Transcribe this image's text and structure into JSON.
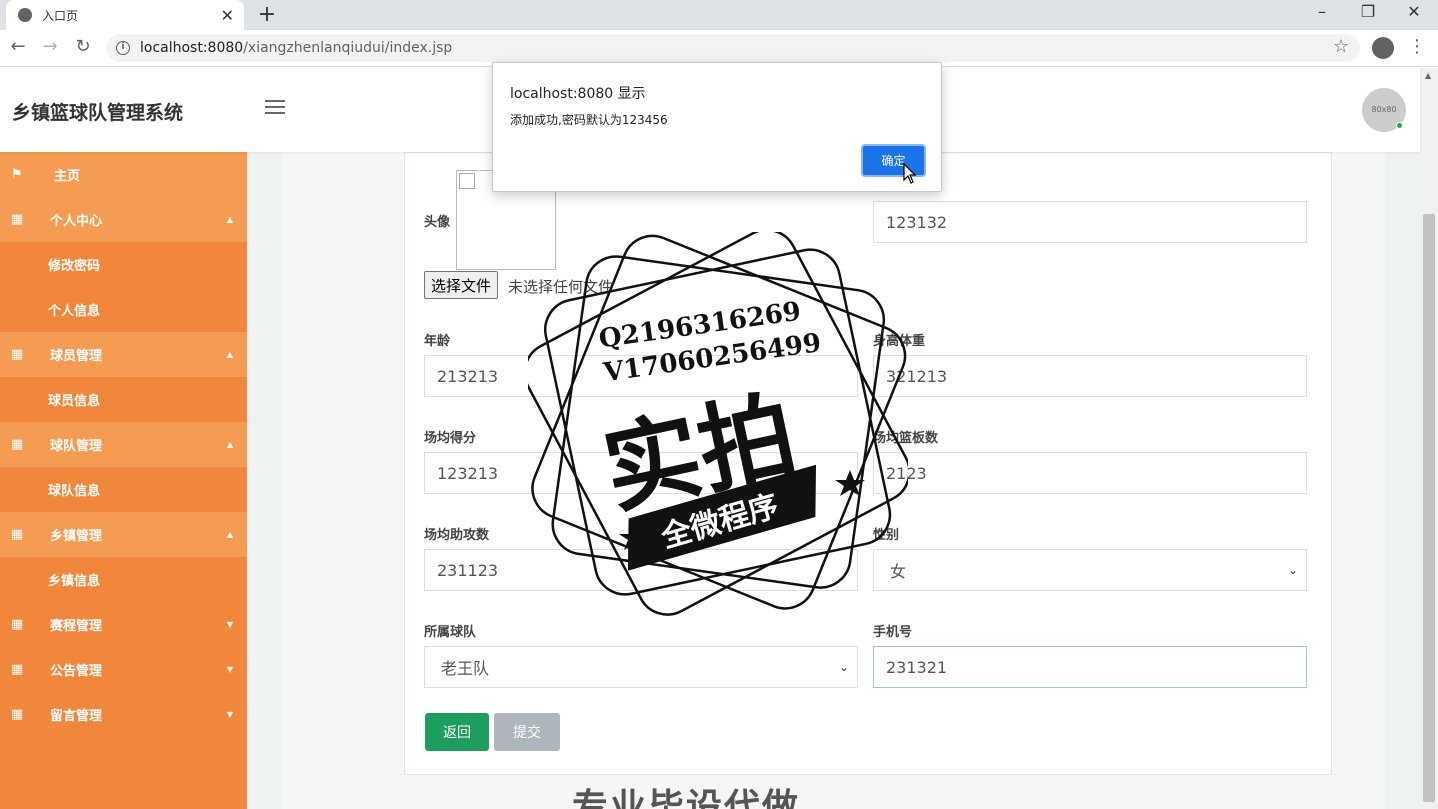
{
  "browser": {
    "tab_title": "入口页",
    "url_host": "localhost:8080",
    "url_path": "/xiangzhenlanqiudui/index.jsp"
  },
  "app": {
    "title": "乡镇篮球队管理系统",
    "avatar_text": "80x80"
  },
  "sidebar": {
    "home": "主页",
    "groups": [
      {
        "label": "个人中心",
        "caret": "▲",
        "children": [
          "修改密码",
          "个人信息"
        ]
      },
      {
        "label": "球员管理",
        "caret": "▲",
        "children": [
          "球员信息"
        ]
      },
      {
        "label": "球队管理",
        "caret": "▲",
        "children": [
          "球队信息"
        ]
      },
      {
        "label": "乡镇管理",
        "caret": "▲",
        "children": [
          "乡镇信息"
        ]
      },
      {
        "label": "赛程管理",
        "caret": "▼",
        "children": []
      },
      {
        "label": "公告管理",
        "caret": "▼",
        "children": []
      },
      {
        "label": "留言管理",
        "caret": "▼",
        "children": []
      }
    ]
  },
  "form": {
    "avatar_label": "头像",
    "file_button": "选择文件",
    "file_status": "未选择任何文件",
    "right_top_value": "123132",
    "age_label": "年龄",
    "age_value": "213213",
    "height_weight_label": "身高体重",
    "height_weight_value": "321213",
    "avg_points_label": "场均得分",
    "avg_points_value": "123213",
    "avg_rebounds_label": "场均篮板数",
    "avg_rebounds_value": "2123",
    "avg_assists_label": "场均助攻数",
    "avg_assists_value": "231123",
    "gender_label": "性别",
    "gender_value": "女",
    "team_label": "所属球队",
    "team_value": "老王队",
    "phone_label": "手机号",
    "phone_value": "231321",
    "back_button": "返回",
    "submit_button": "提交"
  },
  "watermark": {
    "line1": "Q2196316269",
    "line2": "V17060256499",
    "big": "实拍",
    "banner": "全微程序",
    "bottom": "专业毕设代做"
  },
  "dialog": {
    "title": "localhost:8080 显示",
    "message": "添加成功,密码默认为123456",
    "ok_button": "确定"
  }
}
